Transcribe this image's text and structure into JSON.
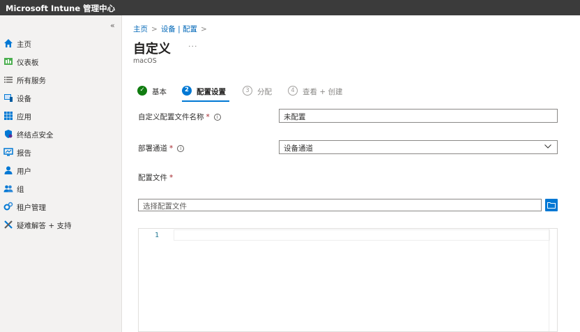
{
  "header": {
    "title": "Microsoft Intune 管理中心"
  },
  "sidebar": {
    "collapse_glyph": "«",
    "items": [
      {
        "label": "主页",
        "icon": "home-icon"
      },
      {
        "label": "仪表板",
        "icon": "dashboard-icon"
      },
      {
        "label": "所有服务",
        "icon": "list-icon"
      },
      {
        "label": "设备",
        "icon": "devices-icon"
      },
      {
        "label": "应用",
        "icon": "apps-icon"
      },
      {
        "label": "终结点安全",
        "icon": "shield-icon"
      },
      {
        "label": "报告",
        "icon": "reports-icon"
      },
      {
        "label": "用户",
        "icon": "user-icon"
      },
      {
        "label": "组",
        "icon": "groups-icon"
      },
      {
        "label": "租户管理",
        "icon": "tenant-icon"
      },
      {
        "label": "疑难解答 + 支持",
        "icon": "troubleshoot-icon"
      }
    ]
  },
  "breadcrumb": {
    "items": [
      "主页",
      "设备 | 配置"
    ],
    "separator": ">"
  },
  "page": {
    "title": "自定义",
    "more": "···",
    "subtitle": "macOS"
  },
  "steps": [
    {
      "number": "✓",
      "label": "基本",
      "state": "done"
    },
    {
      "number": "2",
      "label": "配置设置",
      "state": "active"
    },
    {
      "number": "3",
      "label": "分配",
      "state": "pending"
    },
    {
      "number": "4",
      "label": "查看 + 创建",
      "state": "pending"
    }
  ],
  "form": {
    "profile_name": {
      "label": "自定义配置文件名称",
      "required": "*",
      "info": "i",
      "value": "未配置"
    },
    "channel": {
      "label": "部署通道",
      "required": "*",
      "info": "i",
      "value": "设备通道"
    },
    "config_file": {
      "label": "配置文件",
      "required": "*",
      "placeholder": "选择配置文件"
    }
  },
  "editor": {
    "line_number": "1"
  },
  "colors": {
    "accent": "#0078d4",
    "success": "#107c10",
    "topbar": "#3b3b3b",
    "sidebar": "#f3f2f1"
  }
}
